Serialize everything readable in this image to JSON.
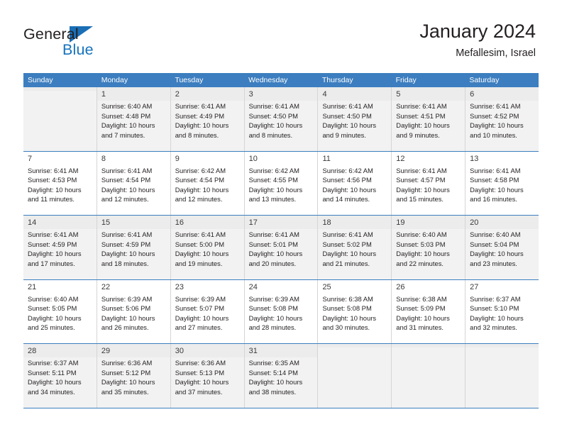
{
  "brand": {
    "name_top": "General",
    "name_bottom": "Blue",
    "color_primary": "#1673bd",
    "color_text": "#231f20"
  },
  "header": {
    "title": "January 2024",
    "subtitle": "Mefallesim, Israel"
  },
  "calendar": {
    "accent_color": "#3c7ebf",
    "alt_row_color": "#f2f2f2",
    "labels": {
      "sunrise": "Sunrise:",
      "sunset": "Sunset:",
      "daylight": "Daylight:"
    },
    "day_names": [
      "Sunday",
      "Monday",
      "Tuesday",
      "Wednesday",
      "Thursday",
      "Friday",
      "Saturday"
    ],
    "weeks": [
      [
        {
          "day": "",
          "sunrise": "",
          "sunset": "",
          "daylight": "",
          "daylight_2": ""
        },
        {
          "day": "1",
          "sunrise": "Sunrise: 6:40 AM",
          "sunset": "Sunset: 4:48 PM",
          "daylight": "Daylight: 10 hours",
          "daylight_2": "and 7 minutes."
        },
        {
          "day": "2",
          "sunrise": "Sunrise: 6:41 AM",
          "sunset": "Sunset: 4:49 PM",
          "daylight": "Daylight: 10 hours",
          "daylight_2": "and 8 minutes."
        },
        {
          "day": "3",
          "sunrise": "Sunrise: 6:41 AM",
          "sunset": "Sunset: 4:50 PM",
          "daylight": "Daylight: 10 hours",
          "daylight_2": "and 8 minutes."
        },
        {
          "day": "4",
          "sunrise": "Sunrise: 6:41 AM",
          "sunset": "Sunset: 4:50 PM",
          "daylight": "Daylight: 10 hours",
          "daylight_2": "and 9 minutes."
        },
        {
          "day": "5",
          "sunrise": "Sunrise: 6:41 AM",
          "sunset": "Sunset: 4:51 PM",
          "daylight": "Daylight: 10 hours",
          "daylight_2": "and 9 minutes."
        },
        {
          "day": "6",
          "sunrise": "Sunrise: 6:41 AM",
          "sunset": "Sunset: 4:52 PM",
          "daylight": "Daylight: 10 hours",
          "daylight_2": "and 10 minutes."
        }
      ],
      [
        {
          "day": "7",
          "sunrise": "Sunrise: 6:41 AM",
          "sunset": "Sunset: 4:53 PM",
          "daylight": "Daylight: 10 hours",
          "daylight_2": "and 11 minutes."
        },
        {
          "day": "8",
          "sunrise": "Sunrise: 6:41 AM",
          "sunset": "Sunset: 4:54 PM",
          "daylight": "Daylight: 10 hours",
          "daylight_2": "and 12 minutes."
        },
        {
          "day": "9",
          "sunrise": "Sunrise: 6:42 AM",
          "sunset": "Sunset: 4:54 PM",
          "daylight": "Daylight: 10 hours",
          "daylight_2": "and 12 minutes."
        },
        {
          "day": "10",
          "sunrise": "Sunrise: 6:42 AM",
          "sunset": "Sunset: 4:55 PM",
          "daylight": "Daylight: 10 hours",
          "daylight_2": "and 13 minutes."
        },
        {
          "day": "11",
          "sunrise": "Sunrise: 6:42 AM",
          "sunset": "Sunset: 4:56 PM",
          "daylight": "Daylight: 10 hours",
          "daylight_2": "and 14 minutes."
        },
        {
          "day": "12",
          "sunrise": "Sunrise: 6:41 AM",
          "sunset": "Sunset: 4:57 PM",
          "daylight": "Daylight: 10 hours",
          "daylight_2": "and 15 minutes."
        },
        {
          "day": "13",
          "sunrise": "Sunrise: 6:41 AM",
          "sunset": "Sunset: 4:58 PM",
          "daylight": "Daylight: 10 hours",
          "daylight_2": "and 16 minutes."
        }
      ],
      [
        {
          "day": "14",
          "sunrise": "Sunrise: 6:41 AM",
          "sunset": "Sunset: 4:59 PM",
          "daylight": "Daylight: 10 hours",
          "daylight_2": "and 17 minutes."
        },
        {
          "day": "15",
          "sunrise": "Sunrise: 6:41 AM",
          "sunset": "Sunset: 4:59 PM",
          "daylight": "Daylight: 10 hours",
          "daylight_2": "and 18 minutes."
        },
        {
          "day": "16",
          "sunrise": "Sunrise: 6:41 AM",
          "sunset": "Sunset: 5:00 PM",
          "daylight": "Daylight: 10 hours",
          "daylight_2": "and 19 minutes."
        },
        {
          "day": "17",
          "sunrise": "Sunrise: 6:41 AM",
          "sunset": "Sunset: 5:01 PM",
          "daylight": "Daylight: 10 hours",
          "daylight_2": "and 20 minutes."
        },
        {
          "day": "18",
          "sunrise": "Sunrise: 6:41 AM",
          "sunset": "Sunset: 5:02 PM",
          "daylight": "Daylight: 10 hours",
          "daylight_2": "and 21 minutes."
        },
        {
          "day": "19",
          "sunrise": "Sunrise: 6:40 AM",
          "sunset": "Sunset: 5:03 PM",
          "daylight": "Daylight: 10 hours",
          "daylight_2": "and 22 minutes."
        },
        {
          "day": "20",
          "sunrise": "Sunrise: 6:40 AM",
          "sunset": "Sunset: 5:04 PM",
          "daylight": "Daylight: 10 hours",
          "daylight_2": "and 23 minutes."
        }
      ],
      [
        {
          "day": "21",
          "sunrise": "Sunrise: 6:40 AM",
          "sunset": "Sunset: 5:05 PM",
          "daylight": "Daylight: 10 hours",
          "daylight_2": "and 25 minutes."
        },
        {
          "day": "22",
          "sunrise": "Sunrise: 6:39 AM",
          "sunset": "Sunset: 5:06 PM",
          "daylight": "Daylight: 10 hours",
          "daylight_2": "and 26 minutes."
        },
        {
          "day": "23",
          "sunrise": "Sunrise: 6:39 AM",
          "sunset": "Sunset: 5:07 PM",
          "daylight": "Daylight: 10 hours",
          "daylight_2": "and 27 minutes."
        },
        {
          "day": "24",
          "sunrise": "Sunrise: 6:39 AM",
          "sunset": "Sunset: 5:08 PM",
          "daylight": "Daylight: 10 hours",
          "daylight_2": "and 28 minutes."
        },
        {
          "day": "25",
          "sunrise": "Sunrise: 6:38 AM",
          "sunset": "Sunset: 5:08 PM",
          "daylight": "Daylight: 10 hours",
          "daylight_2": "and 30 minutes."
        },
        {
          "day": "26",
          "sunrise": "Sunrise: 6:38 AM",
          "sunset": "Sunset: 5:09 PM",
          "daylight": "Daylight: 10 hours",
          "daylight_2": "and 31 minutes."
        },
        {
          "day": "27",
          "sunrise": "Sunrise: 6:37 AM",
          "sunset": "Sunset: 5:10 PM",
          "daylight": "Daylight: 10 hours",
          "daylight_2": "and 32 minutes."
        }
      ],
      [
        {
          "day": "28",
          "sunrise": "Sunrise: 6:37 AM",
          "sunset": "Sunset: 5:11 PM",
          "daylight": "Daylight: 10 hours",
          "daylight_2": "and 34 minutes."
        },
        {
          "day": "29",
          "sunrise": "Sunrise: 6:36 AM",
          "sunset": "Sunset: 5:12 PM",
          "daylight": "Daylight: 10 hours",
          "daylight_2": "and 35 minutes."
        },
        {
          "day": "30",
          "sunrise": "Sunrise: 6:36 AM",
          "sunset": "Sunset: 5:13 PM",
          "daylight": "Daylight: 10 hours",
          "daylight_2": "and 37 minutes."
        },
        {
          "day": "31",
          "sunrise": "Sunrise: 6:35 AM",
          "sunset": "Sunset: 5:14 PM",
          "daylight": "Daylight: 10 hours",
          "daylight_2": "and 38 minutes."
        },
        {
          "day": "",
          "sunrise": "",
          "sunset": "",
          "daylight": "",
          "daylight_2": ""
        },
        {
          "day": "",
          "sunrise": "",
          "sunset": "",
          "daylight": "",
          "daylight_2": ""
        },
        {
          "day": "",
          "sunrise": "",
          "sunset": "",
          "daylight": "",
          "daylight_2": ""
        }
      ]
    ]
  }
}
